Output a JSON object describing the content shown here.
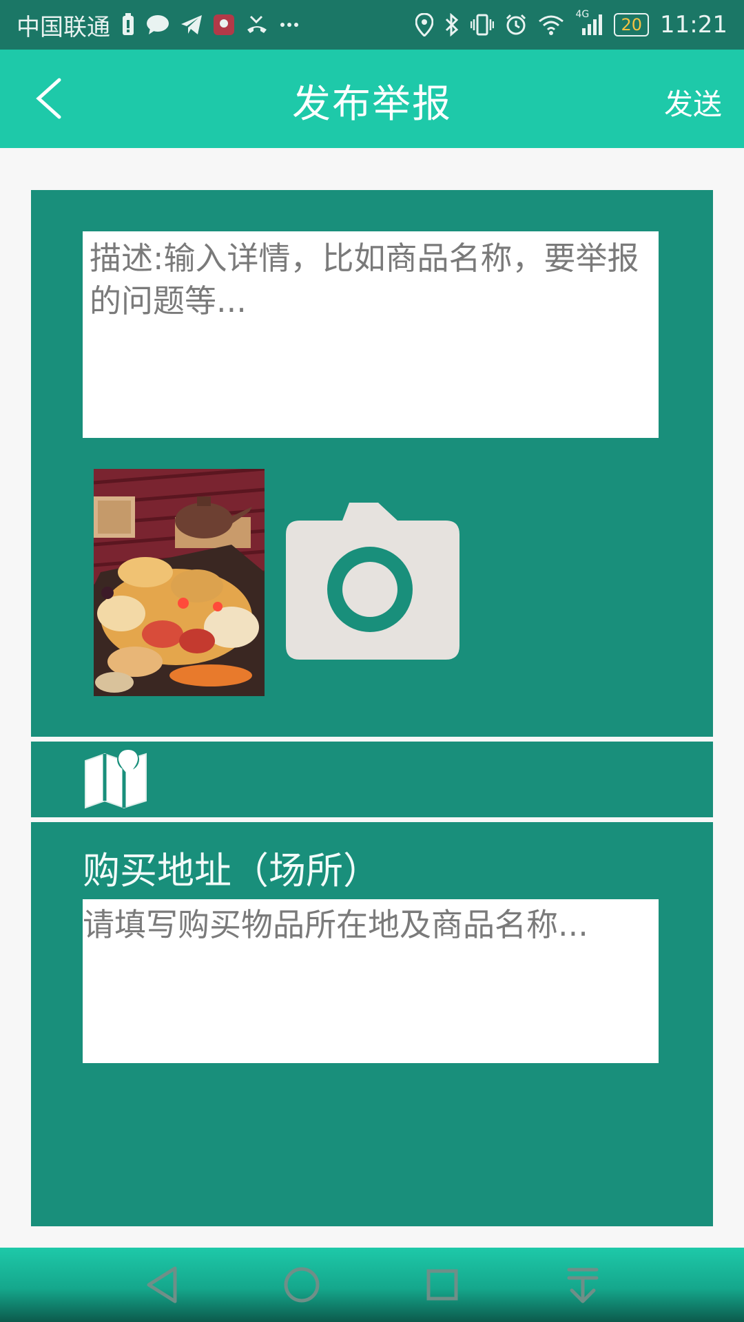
{
  "status_bar": {
    "carrier": "中国联通",
    "notification_icons": [
      "battery-saver-icon",
      "chat-bubble-icon",
      "telegram-icon",
      "huawei-app-icon",
      "missed-call-icon",
      "more-dots-icon"
    ],
    "system_icons": [
      "location-icon",
      "bluetooth-icon",
      "vibrate-icon",
      "alarm-icon",
      "wifi-icon",
      "signal-4g-icon"
    ],
    "network_tag": "4G",
    "battery_level": "20",
    "time": "11:21"
  },
  "header": {
    "title": "发布举报",
    "send_label": "发送"
  },
  "report_form": {
    "description_placeholder": "描述:输入详情，比如商品名称，要举报的问题等...",
    "description_value": "",
    "address_label": "购买地址（场所）",
    "address_placeholder": "请填写购买物品所在地及商品名称...",
    "address_value": ""
  },
  "nav_bar": {
    "buttons": [
      "nav-back-icon",
      "nav-home-icon",
      "nav-recents-icon",
      "nav-notification-pulldown-icon"
    ]
  },
  "colors": {
    "status_bar": "#1b7766",
    "app_bar": "#1ec9a9",
    "panel": "#198f7b",
    "camera_tile": "#e6e2de"
  }
}
